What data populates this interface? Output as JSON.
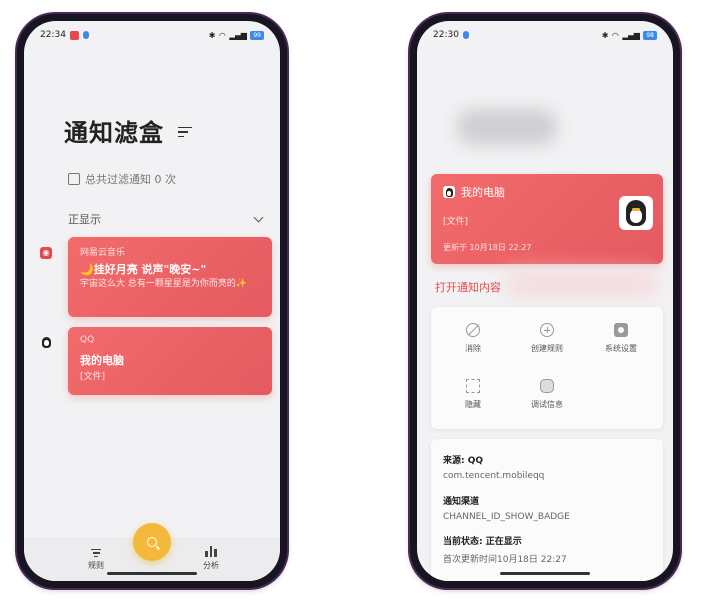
{
  "left": {
    "status": {
      "time": "22:34",
      "battery": "99"
    },
    "app_title": "通知滤盒",
    "total_filtered": "总共过滤通知 0 次",
    "section": "正显示",
    "cards": [
      {
        "source": "网易云音乐",
        "title": "🌙挂好月亮 说声\"晚安~\"",
        "body": "宇宙这么大 总有一颗星星是为你而亮的✨"
      },
      {
        "source": "QQ",
        "title": "我的电脑",
        "body": "[文件]"
      }
    ],
    "nav": {
      "rules": "规则",
      "stats": "分析"
    }
  },
  "right": {
    "status": {
      "time": "22:30",
      "battery": "98"
    },
    "card": {
      "title": "我的电脑",
      "body": "[文件]",
      "updated": "更新于 10月18日 22:27"
    },
    "open_link": "打开通知内容",
    "actions": {
      "dismiss": "消除",
      "create_rule": "创建规则",
      "settings": "系统设置",
      "hide": "隐藏",
      "debug": "调试信息"
    },
    "info": {
      "source": "来源:  QQ",
      "package": "com.tencent.mobileqq",
      "channel_label": "通知渠道",
      "channel": "CHANNEL_ID_SHOW_BADGE",
      "state": "当前状态: 正在显示",
      "first_update": "首次更新时间10月18日 22:27"
    }
  },
  "colors": {
    "card": "#e95d62",
    "accent": "#f4b93a",
    "link": "#e24b50"
  }
}
